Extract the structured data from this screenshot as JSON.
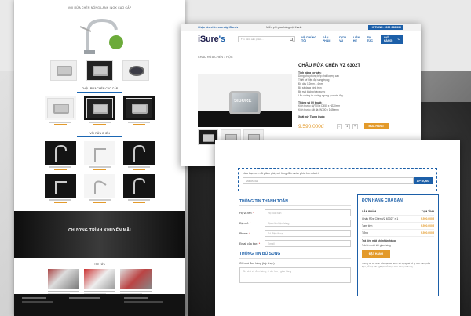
{
  "left_page": {
    "hero_caption": "VÒI RỬA CHÉN NÓNG LẠNH INOX CAO CẤP",
    "section_sinks": "CHẬU RỬA CHÉN CAO CẤP",
    "section_faucets": "VÒI RỬA CHÉN",
    "promo_title": "CHƯƠNG TRÌNH KHUYẾN MÃI",
    "news_title": "TIN TỨC"
  },
  "product_page": {
    "topbar_left": "Chậu rửa chén cao cấp iSure's",
    "topbar_mid": "Miễn phí giao hàng nội thành",
    "hotline": "HOTLINE: 0909 338 339",
    "logo_main": "iSure",
    "logo_accent": "'s",
    "search_placeholder": "Tìm kiếm sản phẩm...",
    "nav": [
      "VỀ CHÚNG TÔI",
      "SẢN PHẨM",
      "DỊCH VỤ",
      "LIÊN HỆ",
      "TIN TỨC"
    ],
    "cart_label": "GIỎ HÀNG",
    "breadcrumb": "CHẬU RỬA CHÉN 1 HỘC",
    "image_brand": "SISURE",
    "title": "CHẬU RỬA CHÉN VZ 6302T",
    "section_features": "Tính năng cơ bản:",
    "features": [
      "Dùng cho phòng bếp chất lượng cao",
      "Thiết kế hiện đại sang trọng",
      "Độ dày 1.2mm – 4mm",
      "Bộ xả dạng hình tròn",
      "Bề mặt không trầy xước",
      "Lắp chống ồn chống ngưng tụ nước đáy"
    ],
    "section_specs": "Thông số kỹ thuật:",
    "specs": [
      "Kích thước: W700 x D450 x H220mm",
      "Kích thước cắt đá: W700 x D450mm"
    ],
    "origin": "Xuất xứ: Trung Quốc",
    "price": "9.590.000đ",
    "qty_minus": "-",
    "qty_value": "1",
    "qty_plus": "+",
    "buy_label": "MUA HÀNG"
  },
  "checkout": {
    "coupon_message": "Nếu bạn có mã giảm giá, vui lòng điền vào phía bên dưới",
    "coupon_placeholder": "Mã ưu đãi",
    "coupon_button": "ÁP DỤNG",
    "billing_title": "THÔNG TIN THANH TOÁN",
    "fields": [
      {
        "label": "Họ và tên:",
        "placeholder": "Họ của bạn"
      },
      {
        "label": "Địa chỉ:",
        "placeholder": "Địa chỉ nhận hàng"
      },
      {
        "label": "Phone:",
        "placeholder": "Số điện thoại"
      },
      {
        "label": "Email của bạn:",
        "placeholder": "Email"
      }
    ],
    "additional_title": "THÔNG TIN BỔ SUNG",
    "order_notes_label": "Ghi chú đơn hàng (tuỳ chọn)",
    "order_notes_placeholder": "Ghi chú về đơn hàng, ví dụ: lưu ý giao hàng",
    "order_title": "ĐƠN HÀNG CỦA BẠN",
    "order_header": [
      "SẢN PHẨM",
      "TẠM TÍNH"
    ],
    "order_item": "Chậu Rửa Chén VZ 6302T × 1",
    "order_item_total": "9.590.000đ",
    "subtotal_label": "Tạm tính",
    "subtotal_value": "9.590.000đ",
    "total_label": "Tổng",
    "total_value": "9.590.000đ",
    "shipping_label": "Trả tiền mặt khi nhận hàng",
    "shipping_option": "Trả tiền mặt khi giao hàng",
    "place_order": "ĐẶT HÀNG",
    "note": "Thông tin cá nhân của bạn sẽ được sử dụng để xử lý đơn hàng của bạn, hỗ trợ trải nghiệm của bạn trên trang web này."
  }
}
